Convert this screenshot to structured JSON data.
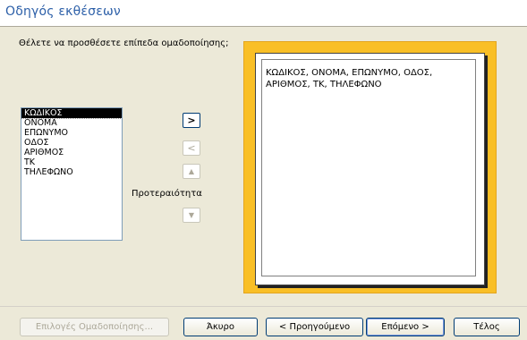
{
  "window": {
    "title": "Οδηγός εκθέσεων"
  },
  "question": "Θέλετε να προσθέσετε επίπεδα ομαδοποίησης;",
  "fields": [
    "ΚΩΔΙΚΟΣ",
    "ΟΝΟΜΑ",
    "ΕΠΩΝΥΜΟ",
    "ΟΔΟΣ",
    "ΑΡΙΘΜΟΣ",
    "ΤΚ",
    "ΤΗΛΕΦΩΝΟ"
  ],
  "selected_field": "ΚΩΔΙΚΟΣ",
  "arrows": {
    "add": ">",
    "remove": "<",
    "up": "▲",
    "down": "▼"
  },
  "priority_label": "Προτεραιότητα",
  "preview": {
    "group_text": "ΚΩΔΙΚΟΣ, ΟΝΟΜΑ, ΕΠΩΝΥΜΟ, ΟΔΟΣ, ΑΡΙΘΜΟΣ, ΤΚ, ΤΗΛΕΦΩΝΟ"
  },
  "buttons": {
    "grouping_options": "Επιλογές Ομαδοποίησης...",
    "cancel": "Άκυρο",
    "back": "< Προηγούμενο",
    "next": "Επόμενο >",
    "finish": "Τέλος"
  },
  "colors": {
    "title": "#2c5fa8",
    "preview_frame": "#f9bf26",
    "button_border": "#003c74"
  }
}
